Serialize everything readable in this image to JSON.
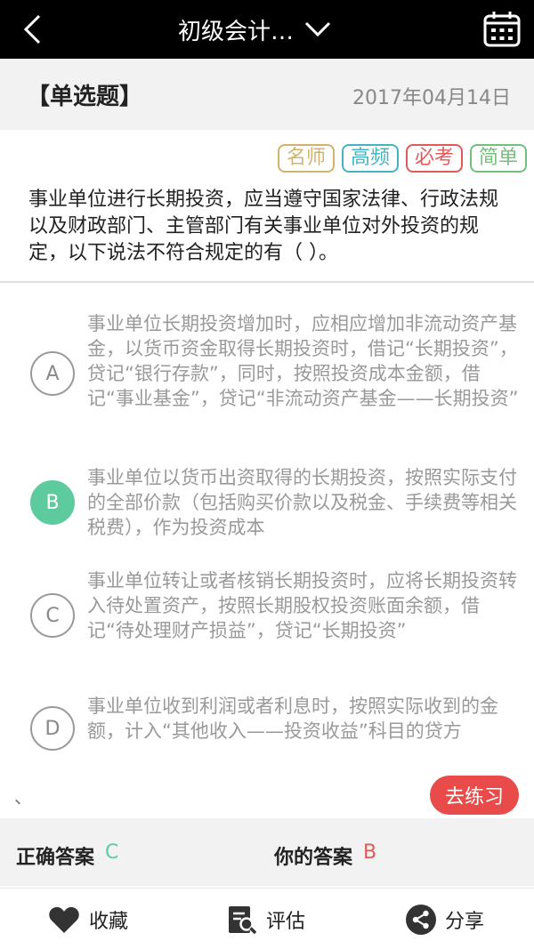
{
  "header": {
    "title": "初级会计…"
  },
  "question_header": {
    "type": "【单选题】",
    "date": "2017年04月14日"
  },
  "tags": [
    {
      "label": "名师",
      "color": "#d2b36b"
    },
    {
      "label": "高频",
      "color": "#46b3c2"
    },
    {
      "label": "必考",
      "color": "#e05a5a"
    },
    {
      "label": "简单",
      "color": "#72c07a"
    }
  ],
  "question": {
    "text": "事业单位进行长期投资，应当遵守国家法律、行政法规以及财政部门、主管部门有关事业单位对外投资的规定，以下说法不符合规定的有（  ）。"
  },
  "options": [
    {
      "letter": "A",
      "text": "事业单位长期投资增加时，应相应增加非流动资产基金，以货币资金取得长期投资时，借记“长期投资”，贷记“银行存款”，同时，按照投资成本金额，借记“事业基金”，贷记“非流动资产基金——长期投资”"
    },
    {
      "letter": "B",
      "text": "事业单位以货币出资取得的长期投资，按照实际支付的全部价款（包括购买价款以及税金、手续费等相关税费），作为投资成本"
    },
    {
      "letter": "C",
      "text": "事业单位转让或者核销长期投资时，应将长期投资转入待处置资产，按照长期股权投资账面余额，借记“待处理财产损益”，贷记“长期投资”"
    },
    {
      "letter": "D",
      "text": "事业单位收到利润或者利息时，按照实际收到的金额，计入“其他收入——投资收益”科目的贷方"
    }
  ],
  "selected_option": "B",
  "stray_mark": "、",
  "practice_button": "去练习",
  "answers": {
    "correct_label": "正确答案",
    "correct_value": "C",
    "correct_color": "#5ecb9f",
    "yours_label": "你的答案",
    "yours_value": "B",
    "yours_color": "#e05a5a"
  },
  "bottom_bar": {
    "favorite": "收藏",
    "evaluate": "评估",
    "share": "分享"
  },
  "colors": {
    "topbar": "#000000",
    "accent_green": "#5ecb9f",
    "practice_red": "#e94b4b"
  }
}
